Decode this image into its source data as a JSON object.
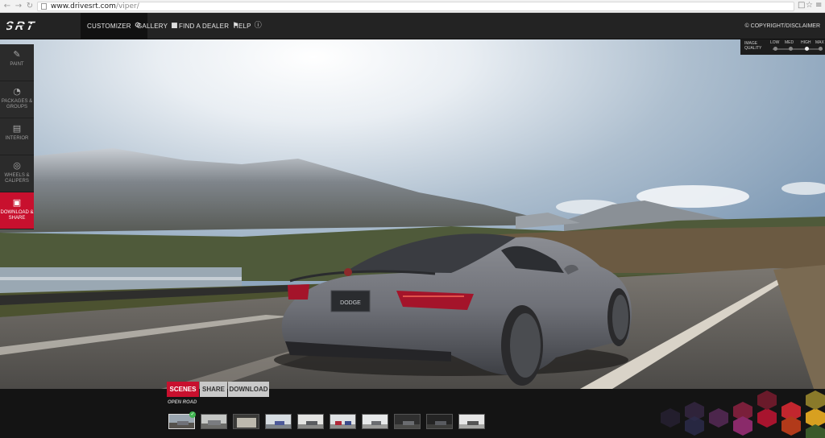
{
  "browser": {
    "url_host": "www.drivesrt.com",
    "url_path": "/viper/",
    "back_icon": "arrow-left-icon",
    "forward_icon": "arrow-right-icon",
    "reload_icon": "reload-icon",
    "star_icon": "star-icon",
    "menu_icon": "menu-icon"
  },
  "brand": {
    "logo_text": "SRT"
  },
  "nav": {
    "items": [
      {
        "label": "CUSTOMIZER",
        "icon": "gear-icon"
      },
      {
        "label": "GALLERY",
        "icon": "gallery-icon"
      },
      {
        "label": "FIND A DEALER",
        "icon": "map-pin-icon"
      },
      {
        "label": "HELP",
        "icon": "info-icon"
      }
    ],
    "copyright": "© COPYRIGHT/DISCLAIMER"
  },
  "sidebar": {
    "items": [
      {
        "label": "PAINT",
        "icon": "paint-icon"
      },
      {
        "label": "PACKAGES & GROUPS",
        "icon": "gauge-icon"
      },
      {
        "label": "INTERIOR",
        "icon": "seat-icon"
      },
      {
        "label": "WHEELS & CALIPERS",
        "icon": "wheel-icon"
      },
      {
        "label": "DOWNLOAD & SHARE",
        "icon": "camera-icon"
      }
    ]
  },
  "image_quality": {
    "label": "IMAGE QUALITY",
    "levels": [
      "LOW",
      "MED",
      "HIGH",
      "MAX"
    ],
    "selected": "HIGH"
  },
  "bottom": {
    "tabs": [
      "SCENES",
      "SHARE",
      "DOWNLOAD"
    ],
    "active_tab": "SCENES",
    "scene_name": "OPEN ROAD",
    "thumbnail_count": 10,
    "selected_thumbnail": 1
  },
  "car": {
    "plate_text": "DODGE"
  },
  "colors": {
    "accent": "#c8102e",
    "nav_bg": "#232323",
    "car_body": "#6f7178"
  }
}
